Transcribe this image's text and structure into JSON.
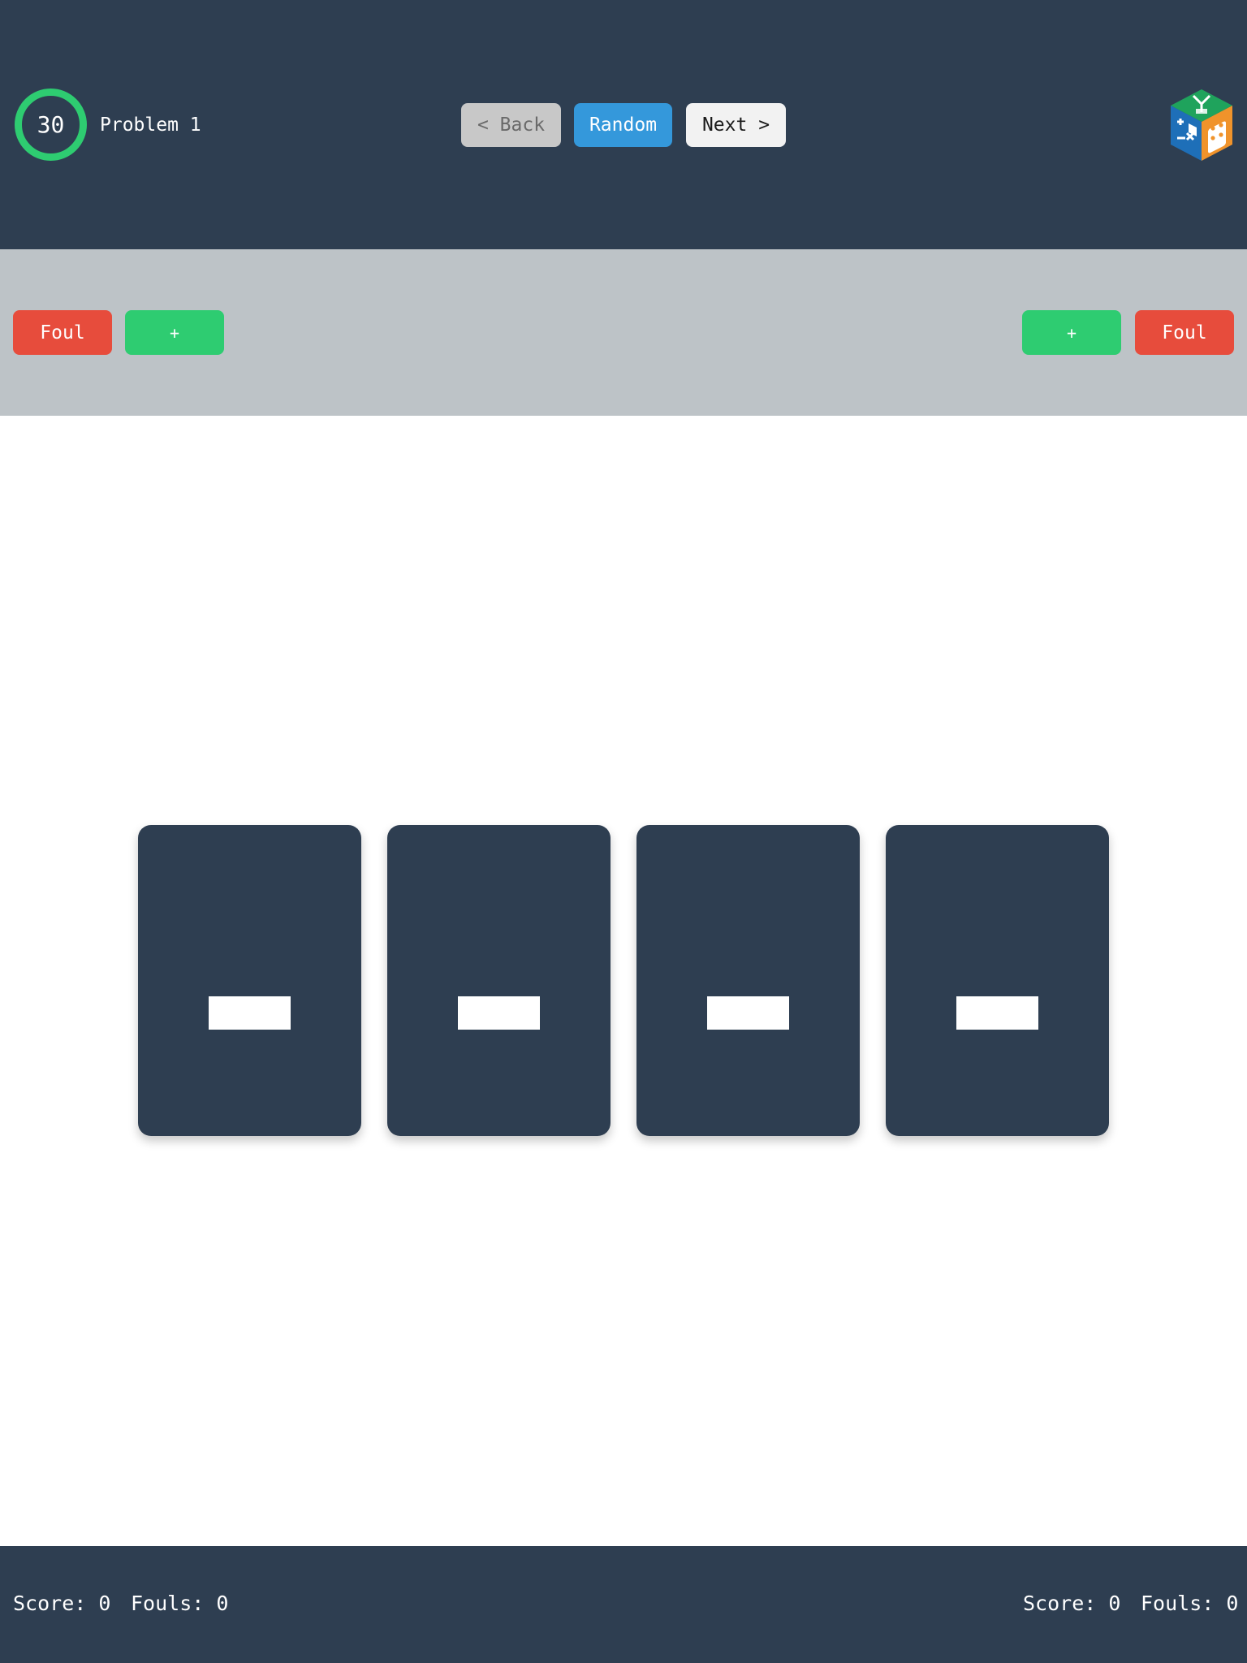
{
  "header": {
    "timer_value": "30",
    "problem_label": "Problem 1",
    "nav": {
      "back_label": "< Back",
      "random_label": "Random",
      "next_label": "Next >"
    },
    "logo_icon": "math-dice-cube-logo"
  },
  "controls": {
    "left": {
      "foul_label": "Foul",
      "plus_label": "+"
    },
    "right": {
      "plus_label": "+",
      "foul_label": "Foul"
    }
  },
  "cards": [
    {
      "value": ""
    },
    {
      "value": ""
    },
    {
      "value": ""
    },
    {
      "value": ""
    }
  ],
  "footer": {
    "left": {
      "score_text": "Score: 0",
      "fouls_text": "Fouls: 0"
    },
    "right": {
      "score_text": "Score: 0",
      "fouls_text": "Fouls: 0"
    }
  },
  "colors": {
    "header_bg": "#2e3e51",
    "control_bar_bg": "#bdc3c7",
    "timer_ring": "#2ecc71",
    "foul": "#e74c3c",
    "plus": "#2ecc71",
    "random": "#3498db",
    "card": "#2e3e51"
  }
}
